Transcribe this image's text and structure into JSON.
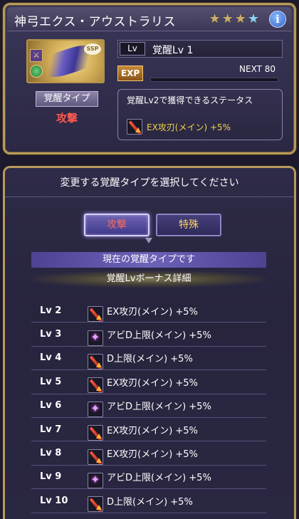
{
  "header": {
    "character_name": "神弓エクス・アウストラリス",
    "stars": [
      "bronze",
      "bronze",
      "bronze",
      "blue"
    ],
    "info_label": "i"
  },
  "portrait": {
    "rarity": "SSP"
  },
  "awakening_type": {
    "label": "覚醒タイプ",
    "value": "攻撃"
  },
  "level": {
    "tag": "Lv",
    "text": "覚醒Lv 1"
  },
  "exp": {
    "tag": "EXP",
    "next": "NEXT 80",
    "progress": 0.0
  },
  "status_box": {
    "caption": "覚醒Lv2で獲得できるステータス",
    "item_icon": "sword-icon",
    "item_text": "EX攻刃(メイン) +5%"
  },
  "panel": {
    "header": "変更する覚醒タイプを選択してください",
    "buttons": {
      "attack": "攻撃",
      "special": "特殊"
    },
    "current_banner": "現在の覚醒タイプです",
    "bonus_header": "覚醒Lvボーナス詳細",
    "bonus_rows": [
      {
        "lv": "Lv 2",
        "icon": "sword-icon",
        "text": "EX攻刃(メイン) +5%"
      },
      {
        "lv": "Lv 3",
        "icon": "spark-icon",
        "text": "アビD上限(メイン) +5%"
      },
      {
        "lv": "Lv 4",
        "icon": "sword-icon",
        "text": "D上限(メイン) +5%"
      },
      {
        "lv": "Lv 5",
        "icon": "sword-icon",
        "text": "EX攻刃(メイン) +5%"
      },
      {
        "lv": "Lv 6",
        "icon": "spark-icon",
        "text": "アビD上限(メイン) +5%"
      },
      {
        "lv": "Lv 7",
        "icon": "sword-icon",
        "text": "EX攻刃(メイン) +5%"
      },
      {
        "lv": "Lv 8",
        "icon": "sword-icon",
        "text": "EX攻刃(メイン) +5%"
      },
      {
        "lv": "Lv 9",
        "icon": "spark-icon",
        "text": "アビD上限(メイン) +5%"
      },
      {
        "lv": "Lv 10",
        "icon": "sword-icon",
        "text": "D上限(メイン) +5%"
      }
    ]
  },
  "colors": {
    "accent_gold": "#b79a5e",
    "attack_red": "#ff5a50",
    "special_yellow": "#ffd35a",
    "status_yellow": "#f2d44a"
  }
}
